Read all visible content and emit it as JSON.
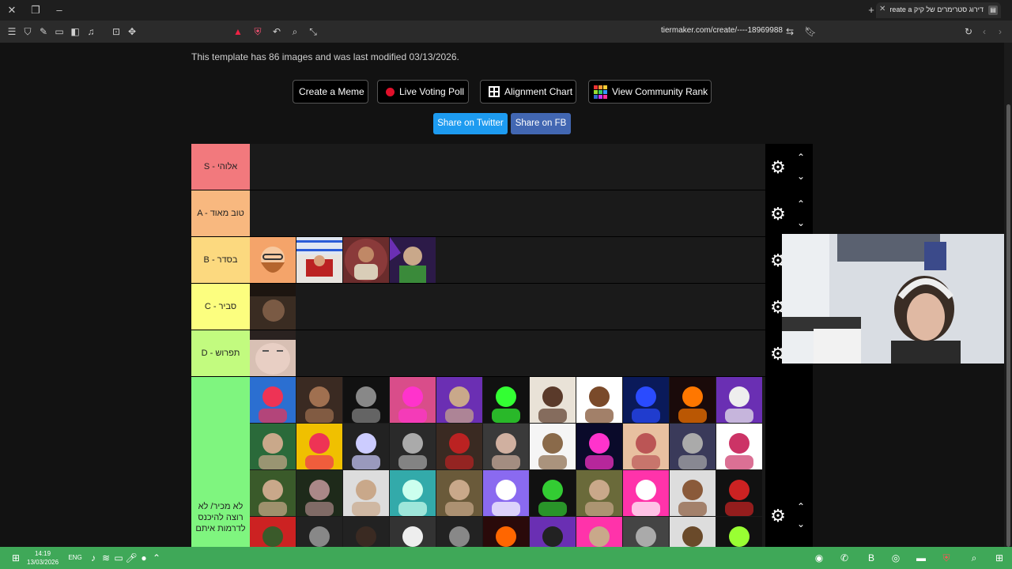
{
  "browser": {
    "tab_title": "דירוג סטרימרים של קיק Create a",
    "url": "tiermaker.com/create/----18969988"
  },
  "page": {
    "info_text": "This template has 86 images and was last modified 03/13/2026.",
    "buttons": {
      "create_meme": "Create a Meme",
      "live_poll": "Live Voting Poll",
      "alignment_chart": "Alignment Chart",
      "community_rank": "View Community Rank"
    },
    "share": {
      "twitter": "Share on Twitter",
      "fb": "Share on FB"
    }
  },
  "tiers": [
    {
      "label": "S - אלוהי",
      "color": "#f2797d"
    },
    {
      "label": "A - טוב מאוד",
      "color": "#f8b87f"
    },
    {
      "label": "B - בסדר",
      "color": "#fcd97f"
    },
    {
      "label": "C - סביר",
      "color": "#fcfe7f"
    },
    {
      "label": "D - תפרוש",
      "color": "#c2fb7f"
    },
    {
      "label": "לא מכיר/ לא רוצה להיכנס לדרמות איתם",
      "color": "#7ff57f"
    }
  ],
  "taskbar": {
    "time": "14:19",
    "date": "13/03/2026",
    "lang": "ENG"
  },
  "colors": {
    "twitter": "#1d9bf0",
    "facebook": "#4267b2",
    "taskbar": "#3fa858"
  }
}
